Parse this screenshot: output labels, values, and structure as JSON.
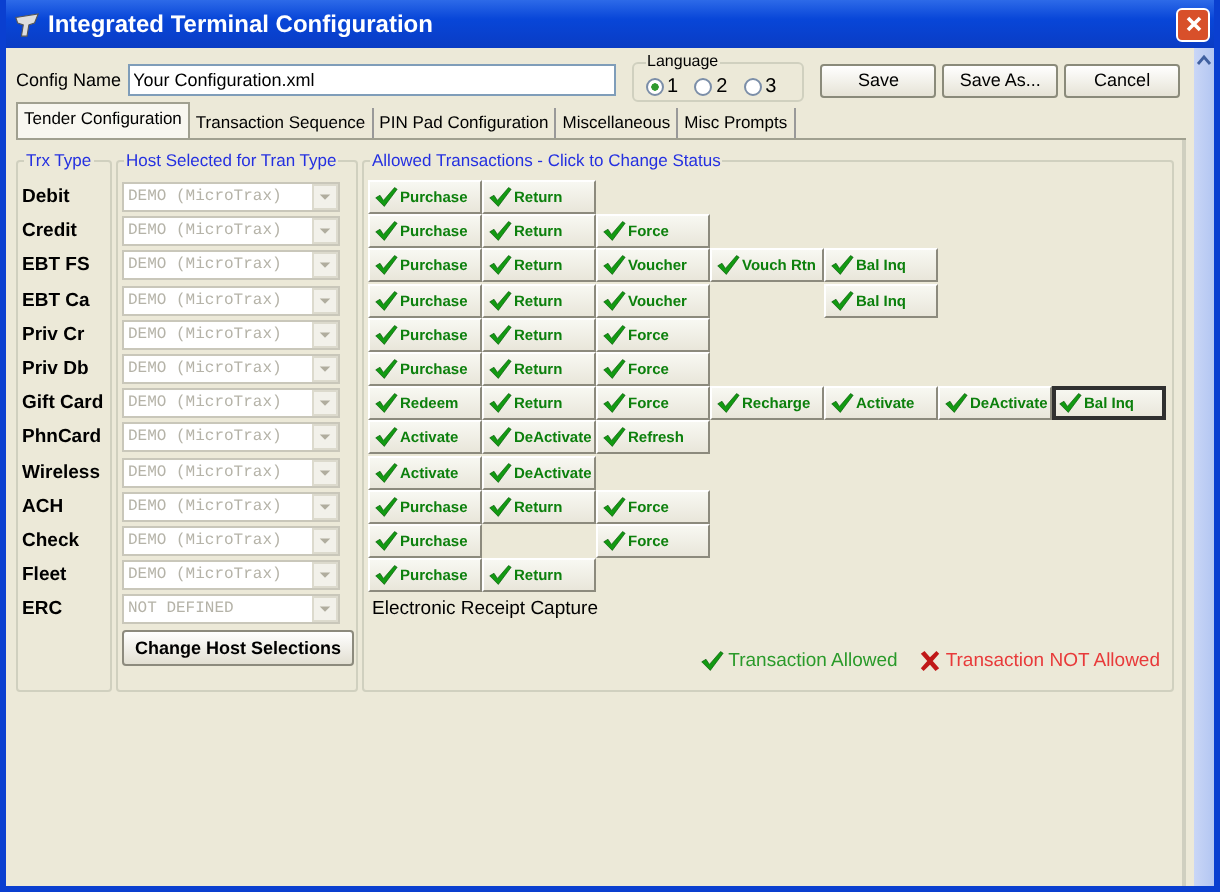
{
  "window": {
    "title": "Integrated Terminal Configuration"
  },
  "config_name": {
    "label": "Config Name",
    "value": "Your Configuration.xml"
  },
  "language": {
    "label": "Language",
    "options": [
      {
        "label": "1",
        "selected": true
      },
      {
        "label": "2",
        "selected": false
      },
      {
        "label": "3",
        "selected": false
      }
    ]
  },
  "buttons": [
    "Save",
    "Save As...",
    "Cancel"
  ],
  "tabs": [
    {
      "label": "Tender Configuration",
      "selected": true
    },
    {
      "label": "Transaction Sequence",
      "selected": false
    },
    {
      "label": "PIN Pad Configuration",
      "selected": false
    },
    {
      "label": "Miscellaneous",
      "selected": false
    },
    {
      "label": "Misc Prompts",
      "selected": false
    }
  ],
  "groups": {
    "trx_type": "Trx Type",
    "host": "Host Selected for Tran Type",
    "allowed": "Allowed Transactions - Click to Change Status"
  },
  "rows": [
    {
      "type": "Debit",
      "host": "DEMO (MicroTrax)",
      "cells": [
        {
          "label": "Purchase",
          "allowed": true,
          "focused": false
        },
        {
          "label": "Return",
          "allowed": true,
          "focused": false
        }
      ]
    },
    {
      "type": "Credit",
      "host": "DEMO (MicroTrax)",
      "cells": [
        {
          "label": "Purchase",
          "allowed": true,
          "focused": false
        },
        {
          "label": "Return",
          "allowed": true,
          "focused": false
        },
        {
          "label": "Force",
          "allowed": true,
          "focused": false
        }
      ]
    },
    {
      "type": "EBT FS",
      "host": "DEMO (MicroTrax)",
      "cells": [
        {
          "label": "Purchase",
          "allowed": true,
          "focused": false
        },
        {
          "label": "Return",
          "allowed": true,
          "focused": false
        },
        {
          "label": "Voucher",
          "allowed": true,
          "focused": false
        },
        {
          "label": "Vouch Rtn",
          "allowed": true,
          "focused": false
        },
        {
          "label": "Bal Inq",
          "allowed": true,
          "focused": false
        }
      ]
    },
    {
      "type": "EBT Ca",
      "host": "DEMO (MicroTrax)",
      "cells": [
        {
          "label": "Purchase",
          "allowed": true,
          "focused": false
        },
        {
          "label": "Return",
          "allowed": true,
          "focused": false
        },
        {
          "label": "Voucher",
          "allowed": true,
          "focused": false
        },
        null,
        {
          "label": "Bal Inq",
          "allowed": true,
          "focused": false
        }
      ]
    },
    {
      "type": "Priv Cr",
      "host": "DEMO (MicroTrax)",
      "cells": [
        {
          "label": "Purchase",
          "allowed": true,
          "focused": false
        },
        {
          "label": "Return",
          "allowed": true,
          "focused": false
        },
        {
          "label": "Force",
          "allowed": true,
          "focused": false
        }
      ]
    },
    {
      "type": "Priv Db",
      "host": "DEMO (MicroTrax)",
      "cells": [
        {
          "label": "Purchase",
          "allowed": true,
          "focused": false
        },
        {
          "label": "Return",
          "allowed": true,
          "focused": false
        },
        {
          "label": "Force",
          "allowed": true,
          "focused": false
        }
      ]
    },
    {
      "type": "Gift Card",
      "host": "DEMO (MicroTrax)",
      "cells": [
        {
          "label": "Redeem",
          "allowed": true,
          "focused": false
        },
        {
          "label": "Return",
          "allowed": true,
          "focused": false
        },
        {
          "label": "Force",
          "allowed": true,
          "focused": false
        },
        {
          "label": "Recharge",
          "allowed": true,
          "focused": false
        },
        {
          "label": "Activate",
          "allowed": true,
          "focused": false
        },
        {
          "label": "DeActivate",
          "allowed": true,
          "focused": false
        },
        {
          "label": "Bal Inq",
          "allowed": true,
          "focused": true
        }
      ]
    },
    {
      "type": "PhnCard",
      "host": "DEMO (MicroTrax)",
      "cells": [
        {
          "label": "Activate",
          "allowed": true,
          "focused": false
        },
        {
          "label": "DeActivate",
          "allowed": true,
          "focused": false
        },
        {
          "label": "Refresh",
          "allowed": true,
          "focused": false
        }
      ]
    },
    {
      "type": "Wireless",
      "host": "DEMO (MicroTrax)",
      "cells": [
        {
          "label": "Activate",
          "allowed": true,
          "focused": false
        },
        {
          "label": "DeActivate",
          "allowed": true,
          "focused": false
        }
      ]
    },
    {
      "type": "ACH",
      "host": "DEMO (MicroTrax)",
      "cells": [
        {
          "label": "Purchase",
          "allowed": true,
          "focused": false
        },
        {
          "label": "Return",
          "allowed": true,
          "focused": false
        },
        {
          "label": "Force",
          "allowed": true,
          "focused": false
        }
      ]
    },
    {
      "type": "Check",
      "host": "DEMO (MicroTrax)",
      "cells": [
        {
          "label": "Purchase",
          "allowed": true,
          "focused": false
        },
        null,
        {
          "label": "Force",
          "allowed": true,
          "focused": false
        }
      ]
    },
    {
      "type": "Fleet",
      "host": "DEMO (MicroTrax)",
      "cells": [
        {
          "label": "Purchase",
          "allowed": true,
          "focused": false
        },
        {
          "label": "Return",
          "allowed": true,
          "focused": false
        }
      ]
    },
    {
      "type": "ERC",
      "host": "NOT DEFINED",
      "note": "Electronic Receipt Capture"
    }
  ],
  "change_host_button": "Change Host Selections",
  "legend": {
    "allowed": "Transaction Allowed",
    "not_allowed": "Transaction NOT Allowed"
  }
}
